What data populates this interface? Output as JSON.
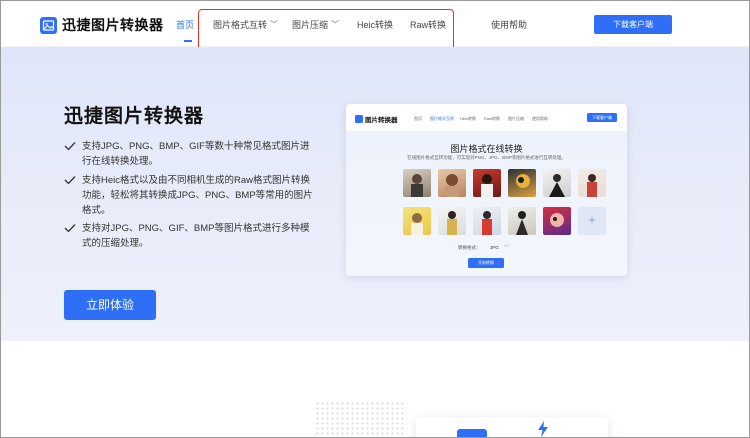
{
  "header": {
    "logo_text": "迅捷图片转换器",
    "nav": [
      {
        "label": "首页",
        "active": true
      },
      {
        "label": "图片格式互转",
        "dropdown": true
      },
      {
        "label": "图片压缩",
        "dropdown": true
      },
      {
        "label": "Heic转换"
      },
      {
        "label": "Raw转换"
      },
      {
        "label": "使用帮助"
      }
    ],
    "download_label": "下载客户端"
  },
  "hero": {
    "title": "迅捷图片转换器",
    "features": [
      "支持JPG、PNG、BMP、GIF等数十种常见格式图片进行在线转换处理。",
      "支持Heic格式以及由不同相机生成的Raw格式图片转换功能，轻松将其转换成JPG、PNG、BMP等常用的图片格式。",
      "支持对JPG、PNG、GIF、BMP等图片格式进行多种模式的压缩处理。"
    ],
    "cta_label": "立即体验"
  },
  "preview": {
    "logo_text": "图片转换器",
    "nav": [
      "首页",
      "图片格式互转",
      "Heic转换",
      "Raw转换",
      "图片压缩",
      "使用帮助"
    ],
    "download_label": "下载客户端",
    "title": "图片格式在线转换",
    "subtitle": "在线图片格式互转功能，可实现对PNG、JPG、BMP等图片格式进行互转处理。",
    "format_label": "转换格式：",
    "format_value": "JPG",
    "start_label": "开始转换",
    "add_symbol": "+"
  },
  "colors": {
    "accent": "#2f6ff7",
    "highlight_border": "#e0342b"
  }
}
